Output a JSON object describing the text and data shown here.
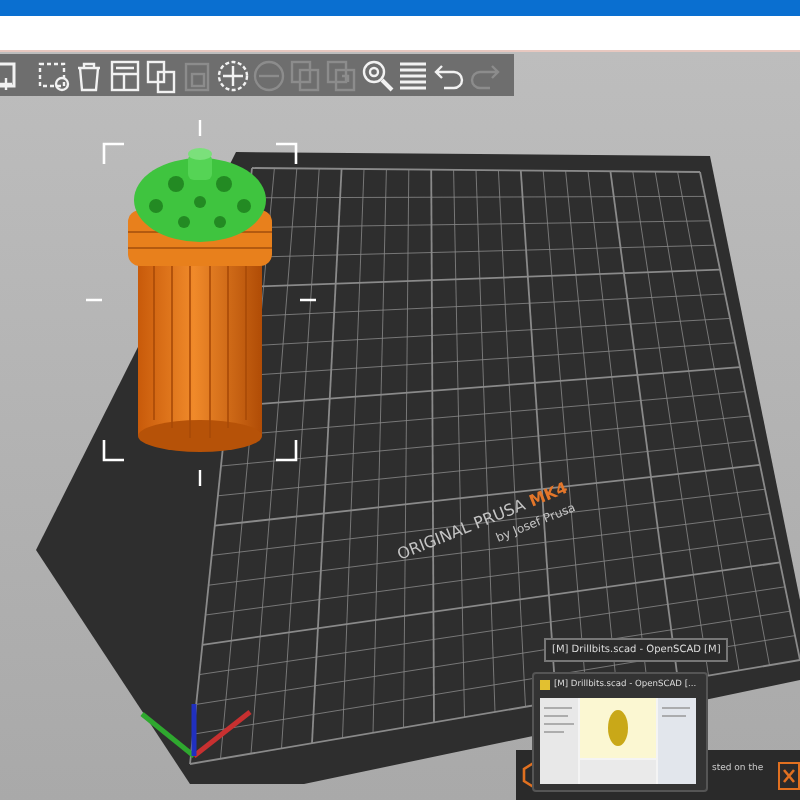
{
  "toolbar": [
    {
      "kind": "add",
      "disabled": false
    },
    {
      "kind": "select",
      "disabled": false
    },
    {
      "kind": "delete",
      "disabled": false
    },
    {
      "kind": "arrange",
      "disabled": false
    },
    {
      "kind": "copy",
      "disabled": false
    },
    {
      "kind": "paste",
      "disabled": true
    },
    {
      "kind": "add-instance",
      "disabled": false
    },
    {
      "kind": "remove-instance",
      "disabled": true
    },
    {
      "kind": "split-objects",
      "disabled": true
    },
    {
      "kind": "split-parts",
      "disabled": true
    },
    {
      "kind": "search",
      "disabled": false
    },
    {
      "kind": "layers",
      "disabled": false
    },
    {
      "kind": "undo",
      "disabled": false
    },
    {
      "kind": "redo",
      "disabled": true
    }
  ],
  "bed": {
    "brand": "ORIGINAL PRUSA",
    "model": "MK4",
    "maker": "by Josef Prusa"
  },
  "taskbar_preview": {
    "tooltip": "[M] Drillbits.scad - OpenSCAD [M]",
    "window_title": "[M] Drillbits.scad - OpenSCAD [...",
    "notification_text": "sted on the"
  }
}
